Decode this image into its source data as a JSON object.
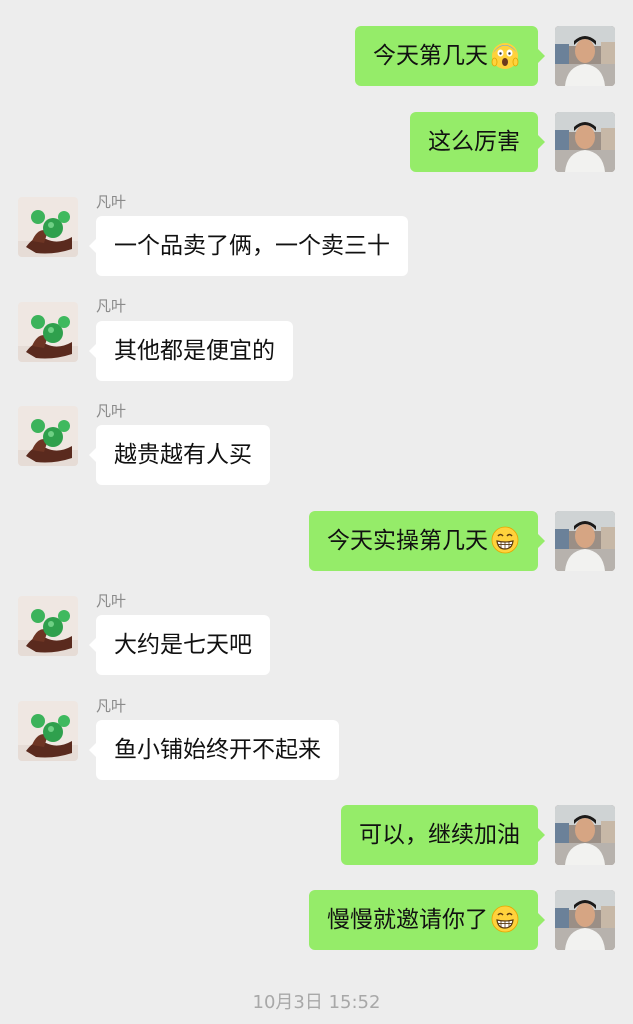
{
  "colors": {
    "background": "#ededed",
    "bubble_incoming": "#ffffff",
    "bubble_outgoing": "#95ec69",
    "sender_name": "#8a8a8a",
    "timestamp": "#a8a8a8"
  },
  "messages": [
    {
      "direction": "out",
      "text": "今天第几天",
      "emoji": "face-screaming-in-fear-emoji"
    },
    {
      "direction": "out",
      "text": "这么厉害"
    },
    {
      "direction": "in",
      "sender": "凡叶",
      "text": "一个品卖了俩，一个卖三十"
    },
    {
      "direction": "in",
      "sender": "凡叶",
      "text": "其他都是便宜的"
    },
    {
      "direction": "in",
      "sender": "凡叶",
      "text": "越贵越有人买"
    },
    {
      "direction": "out",
      "text": "今天实操第几天",
      "emoji": "grinning-face-emoji"
    },
    {
      "direction": "in",
      "sender": "凡叶",
      "text": "大约是七天吧"
    },
    {
      "direction": "in",
      "sender": "凡叶",
      "text": "鱼小铺始终开不起来"
    },
    {
      "direction": "out",
      "text": "可以，继续加油"
    },
    {
      "direction": "out",
      "text": "慢慢就邀请你了",
      "emoji": "grinning-face-emoji"
    }
  ],
  "timestamp": "10月3日 15:52"
}
